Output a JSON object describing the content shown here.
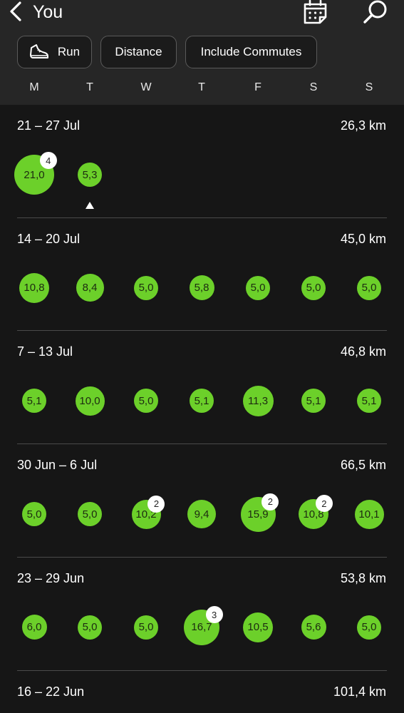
{
  "header": {
    "title": "You",
    "filters": [
      "Run",
      "Distance",
      "Include Commutes"
    ]
  },
  "weekdays": [
    "M",
    "T",
    "W",
    "T",
    "F",
    "S",
    "S"
  ],
  "weeks": [
    {
      "range": "21 – 27 Jul",
      "total": "26,3 km",
      "days": [
        {
          "value": "21,0",
          "count": "4"
        },
        {
          "value": "5,3"
        },
        null,
        null,
        null,
        null,
        null
      ]
    },
    {
      "range": "14 – 20 Jul",
      "total": "45,0 km",
      "days": [
        {
          "value": "10,8"
        },
        {
          "value": "8,4"
        },
        {
          "value": "5,0"
        },
        {
          "value": "5,8"
        },
        {
          "value": "5,0"
        },
        {
          "value": "5,0"
        },
        {
          "value": "5,0"
        }
      ]
    },
    {
      "range": "7 – 13 Jul",
      "total": "46,8 km",
      "days": [
        {
          "value": "5,1"
        },
        {
          "value": "10,0"
        },
        {
          "value": "5,0"
        },
        {
          "value": "5,1"
        },
        {
          "value": "11,3"
        },
        {
          "value": "5,1"
        },
        {
          "value": "5,1"
        }
      ]
    },
    {
      "range": "30 Jun – 6 Jul",
      "total": "66,5 km",
      "days": [
        {
          "value": "5,0"
        },
        {
          "value": "5,0"
        },
        {
          "value": "10,2",
          "count": "2"
        },
        {
          "value": "9,4"
        },
        {
          "value": "15,9",
          "count": "2"
        },
        {
          "value": "10,8",
          "count": "2"
        },
        {
          "value": "10,1"
        }
      ]
    },
    {
      "range": "23 – 29 Jun",
      "total": "53,8 km",
      "days": [
        {
          "value": "6,0"
        },
        {
          "value": "5,0"
        },
        {
          "value": "5,0"
        },
        {
          "value": "16,7",
          "count": "3"
        },
        {
          "value": "10,5"
        },
        {
          "value": "5,6"
        },
        {
          "value": "5,0"
        }
      ]
    },
    {
      "range": "16 – 22 Jun",
      "total": "101,4 km",
      "days": []
    }
  ],
  "icons": {
    "back": "chevron-left-icon",
    "calendar": "calendar-icon",
    "search": "search-icon",
    "run": "running-shoe-icon"
  },
  "colors": {
    "accent": "#6cd02a",
    "header_bg": "#262626",
    "page_bg": "#161616",
    "badge_bg": "#ffffff"
  }
}
